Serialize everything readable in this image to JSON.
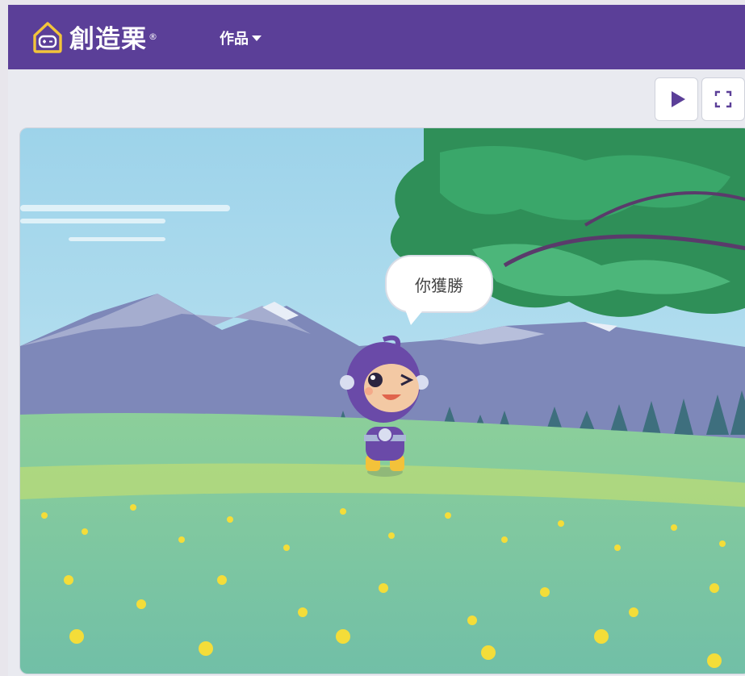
{
  "header": {
    "brand": "創造栗",
    "registered_mark": "®",
    "menu_works_label": "作品",
    "logo_icon": "house-logo-icon"
  },
  "toolbar": {
    "play_icon": "play-icon",
    "fullscreen_icon": "fullscreen-icon"
  },
  "stage": {
    "speech_bubble_text": "你獲勝"
  },
  "colors": {
    "navbar": "#5b3f98",
    "accent": "#5b3f98",
    "sky": "#a8d9ee",
    "grass": "#7fc58f"
  }
}
